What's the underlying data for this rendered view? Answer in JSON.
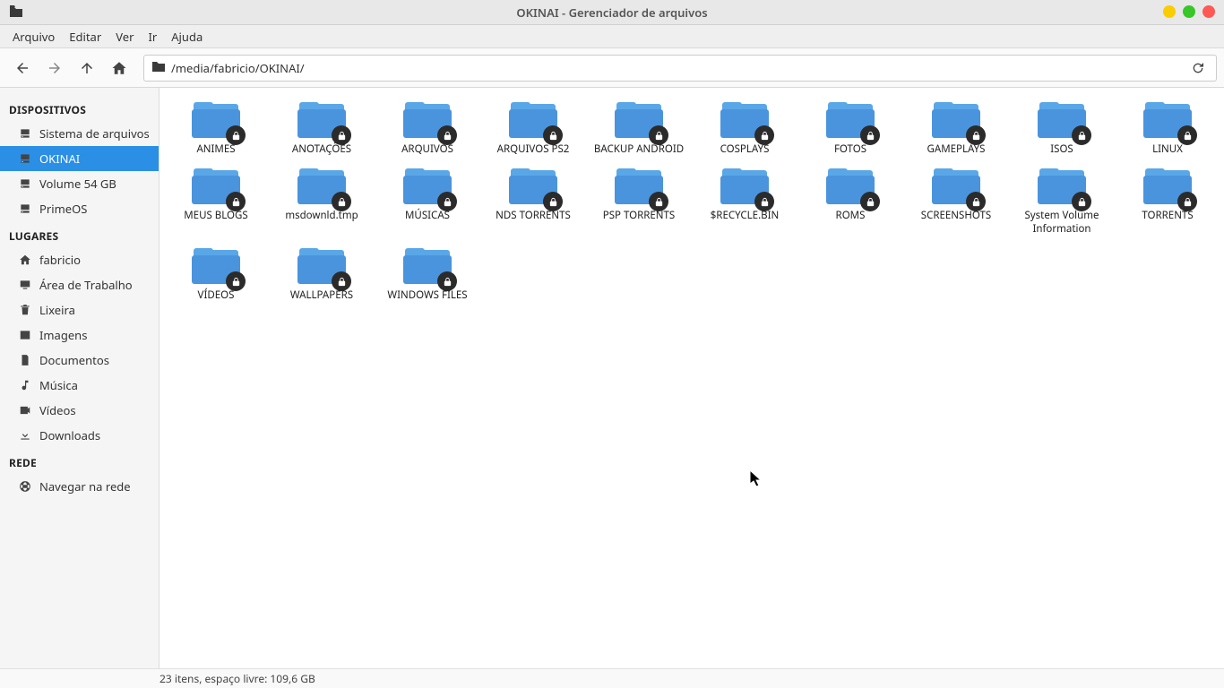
{
  "window": {
    "title": "OKINAI - Gerenciador de arquivos"
  },
  "menu": {
    "items": [
      "Arquivo",
      "Editar",
      "Ver",
      "Ir",
      "Ajuda"
    ]
  },
  "toolbar": {
    "path": "/media/fabricio/OKINAI/"
  },
  "sidebar": {
    "sections": [
      {
        "heading": "DISPOSITIVOS",
        "items": [
          {
            "icon": "drive",
            "label": "Sistema de arquivos",
            "active": false
          },
          {
            "icon": "drive",
            "label": "OKINAI",
            "active": true
          },
          {
            "icon": "drive",
            "label": "Volume 54 GB",
            "active": false
          },
          {
            "icon": "drive",
            "label": "PrimeOS",
            "active": false
          }
        ]
      },
      {
        "heading": "LUGARES",
        "items": [
          {
            "icon": "home",
            "label": "fabricio",
            "active": false
          },
          {
            "icon": "desktop",
            "label": "Área de Trabalho",
            "active": false
          },
          {
            "icon": "trash",
            "label": "Lixeira",
            "active": false
          },
          {
            "icon": "image",
            "label": "Imagens",
            "active": false
          },
          {
            "icon": "document",
            "label": "Documentos",
            "active": false
          },
          {
            "icon": "music",
            "label": "Música",
            "active": false
          },
          {
            "icon": "video",
            "label": "Vídeos",
            "active": false
          },
          {
            "icon": "download",
            "label": "Downloads",
            "active": false
          }
        ]
      },
      {
        "heading": "REDE",
        "items": [
          {
            "icon": "network",
            "label": "Navegar na rede",
            "active": false
          }
        ]
      }
    ]
  },
  "files": {
    "items": [
      {
        "name": "ANIMES"
      },
      {
        "name": "ANOTAÇÕES"
      },
      {
        "name": "ARQUIVOS"
      },
      {
        "name": "ARQUIVOS PS2"
      },
      {
        "name": "BACKUP ANDROID"
      },
      {
        "name": "COSPLAYS"
      },
      {
        "name": "FOTOS"
      },
      {
        "name": "GAMEPLAYS"
      },
      {
        "name": "ISOS"
      },
      {
        "name": "LINUX"
      },
      {
        "name": "MEUS BLOGS"
      },
      {
        "name": "msdownld.tmp"
      },
      {
        "name": "MÚSICAS"
      },
      {
        "name": "NDS TORRENTS"
      },
      {
        "name": "PSP TORRENTS"
      },
      {
        "name": "$RECYCLE.BIN"
      },
      {
        "name": "ROMS"
      },
      {
        "name": "SCREENSHOTS"
      },
      {
        "name": "System Volume Information"
      },
      {
        "name": "TORRENTS"
      },
      {
        "name": "VÍDEOS"
      },
      {
        "name": "WALLPAPERS"
      },
      {
        "name": "WINDOWS FILES"
      }
    ]
  },
  "status": {
    "text": "23 itens, espaço livre: 109,6 GB"
  }
}
